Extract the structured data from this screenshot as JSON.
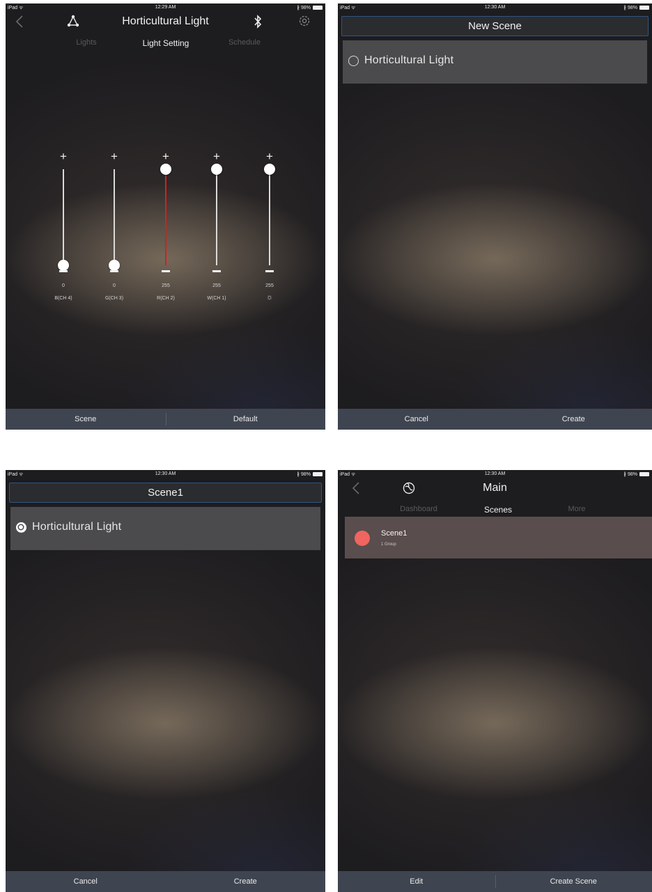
{
  "status": {
    "carrier": "iPad ᯤ",
    "battery": "∦ 98%",
    "times": [
      "12:29 AM",
      "12:30 AM",
      "12:30 AM",
      "12:30 AM"
    ]
  },
  "panel1": {
    "title": "Horticultural Light",
    "icons": {
      "back": "chevron-left-icon",
      "group": "group-icon",
      "bluetooth": "bluetooth-icon",
      "settings": "gear-icon"
    },
    "tabs": [
      "Lights",
      "Light Setting",
      "Schedule"
    ],
    "sliders": [
      {
        "value": "0",
        "label": "B(CH 4)",
        "level": 0
      },
      {
        "value": "0",
        "label": "G(CH 3)",
        "level": 0
      },
      {
        "value": "255",
        "label": "R(CH 2)",
        "level": 1
      },
      {
        "value": "255",
        "label": "W(CH 1)",
        "level": 1
      },
      {
        "value": "255",
        "label": "☼",
        "level": 1
      }
    ],
    "bottom": {
      "left": "Scene",
      "right": "Default"
    }
  },
  "panel2": {
    "scene_name": "New Scene",
    "group": "Horticultural Light",
    "checked": false,
    "bottom": {
      "left": "Cancel",
      "right": "Create"
    }
  },
  "panel3": {
    "scene_name": "Scene1",
    "group": "Horticultural Light",
    "checked": true,
    "bottom": {
      "left": "Cancel",
      "right": "Create"
    }
  },
  "panel4": {
    "title": "Main",
    "tabs": [
      "Dashboard",
      "Scenes",
      "More"
    ],
    "scene": {
      "name": "Scene1",
      "sub": "1 Group",
      "color": "#f06560"
    },
    "bottom": {
      "left": "Edit",
      "right": "Create Scene"
    }
  },
  "colors": {
    "accent_red": "#d32020",
    "bar": "#3f4550",
    "scene_dot": "#f06560"
  }
}
